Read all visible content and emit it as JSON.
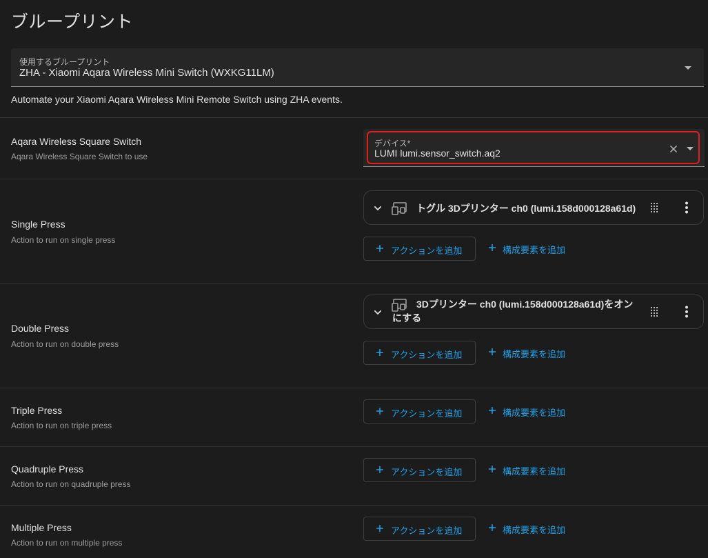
{
  "page_title": "ブループリント",
  "blueprint_select": {
    "label": "使用するブループリント",
    "value": "ZHA - Xiaomi Aqara Wireless Mini Switch (WXKG11LM)"
  },
  "blueprint_description": "Automate your Xiaomi Aqara Wireless Mini Remote Switch using ZHA events.",
  "inputs": {
    "switch": {
      "title": "Aqara Wireless Square Switch",
      "subtitle": "Aqara Wireless Square Switch to use",
      "device_label": "デバイス*",
      "device_value": "LUMI lumi.sensor_switch.aq2"
    },
    "single": {
      "title": "Single Press",
      "subtitle": "Action to run on single press",
      "action_text": "トグル 3Dプリンター ch0 (lumi.158d000128a61d)"
    },
    "double": {
      "title": "Double Press",
      "subtitle": "Action to run on double press",
      "action_text": "3Dプリンター ch0 (lumi.158d000128a61d)をオンにする"
    },
    "triple": {
      "title": "Triple Press",
      "subtitle": "Action to run on triple press"
    },
    "quadruple": {
      "title": "Quadruple Press",
      "subtitle": "Action to run on quadruple press"
    },
    "multiple": {
      "title": "Multiple Press",
      "subtitle": "Action to run on multiple press"
    }
  },
  "buttons": {
    "add_action": "アクションを追加",
    "add_building_block": "構成要素を追加"
  },
  "colors": {
    "background": "#1c1c1c",
    "accent": "#1ea1e8",
    "highlight": "#e01e1e"
  },
  "icons": [
    "chevron-down-icon",
    "close-icon",
    "device-icon",
    "drag-handle-icon",
    "more-vert-icon",
    "plus-icon"
  ]
}
